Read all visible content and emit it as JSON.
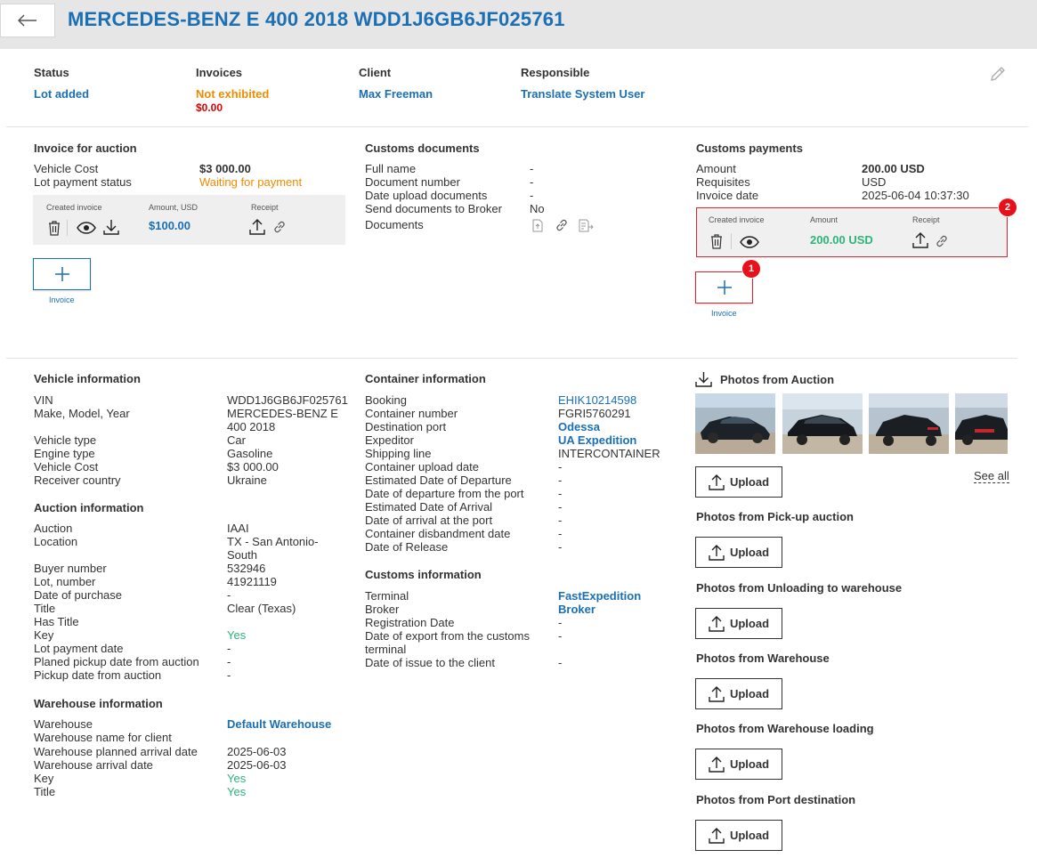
{
  "header": {
    "title": "MERCEDES-BENZ E 400 2018 WDD1J6GB6JF025761"
  },
  "summary": {
    "status_label": "Status",
    "status_value": "Lot added",
    "invoices_label": "Invoices",
    "invoices_value": "Not exhibited",
    "invoices_amount": "$0.00",
    "client_label": "Client",
    "client_value": "Max Freeman",
    "responsible_label": "Responsible",
    "responsible_value": "Translate System User"
  },
  "invoice_auction": {
    "title": "Invoice for auction",
    "rows": [
      {
        "k": "Vehicle Cost",
        "v": "$3 000.00"
      },
      {
        "k": "Lot payment status",
        "v": "Waiting for payment"
      }
    ],
    "table": {
      "col1": "Created invoice",
      "col2": "Amount, USD",
      "col3": "Receipt",
      "amount": "$100.00"
    },
    "add_label": "Invoice"
  },
  "customs_docs": {
    "title": "Customs documents",
    "rows": [
      {
        "k": "Full name",
        "v": "-"
      },
      {
        "k": "Document number",
        "v": "-"
      },
      {
        "k": "Date upload documents",
        "v": "-"
      },
      {
        "k": "Send documents to Broker",
        "v": "No"
      },
      {
        "k": "Documents",
        "v": ""
      }
    ]
  },
  "customs_payments": {
    "title": "Customs payments",
    "rows": [
      {
        "k": "Amount",
        "v": "200.00 USD"
      },
      {
        "k": "Requisites",
        "v": "USD"
      },
      {
        "k": "Invoice date",
        "v": "2025-06-04 10:37:30"
      }
    ],
    "table": {
      "col1": "Created invoice",
      "col2": "Amount",
      "col3": "Receipt",
      "amount": "200.00 USD"
    },
    "add_label": "Invoice",
    "badge1": "1",
    "badge2": "2"
  },
  "vehicle_info": {
    "title": "Vehicle information",
    "rows": [
      {
        "k": "VIN",
        "v": "WDD1J6GB6JF025761"
      },
      {
        "k": "Make, Model, Year",
        "v": "MERCEDES-BENZ E",
        "v2": "400 2018"
      },
      {
        "k": "Vehicle type",
        "v": "Car"
      },
      {
        "k": "Engine type",
        "v": "Gasoline"
      },
      {
        "k": "Vehicle Cost",
        "v": "$3 000.00"
      },
      {
        "k": "Receiver country",
        "v": "Ukraine"
      }
    ]
  },
  "auction_info": {
    "title": "Auction information",
    "rows": [
      {
        "k": "Auction",
        "v": "IAAI"
      },
      {
        "k": "Location",
        "v": "TX - San Antonio-",
        "v2": "South"
      },
      {
        "k": "Buyer number",
        "v": "532946"
      },
      {
        "k": "Lot, number",
        "v": "41921119"
      },
      {
        "k": "Date of purchase",
        "v": "-"
      },
      {
        "k": "Title",
        "v": "Clear (Texas)"
      },
      {
        "k": "Has Title",
        "v": ""
      },
      {
        "k": "Key",
        "v": "Yes"
      },
      {
        "k": "Lot payment date",
        "v": "-"
      },
      {
        "k": "Planed pickup date from auction",
        "v": "-"
      },
      {
        "k": "Pickup date from auction",
        "v": "-"
      }
    ]
  },
  "warehouse_info": {
    "title": "Warehouse information",
    "rows": [
      {
        "k": "Warehouse",
        "v": "Default Warehouse"
      },
      {
        "k": "Warehouse name for client",
        "v": ""
      },
      {
        "k": "Warehouse planned arrival date",
        "v": "2025-06-03"
      },
      {
        "k": "Warehouse arrival date",
        "v": "2025-06-03"
      },
      {
        "k": "Key",
        "v": "Yes"
      },
      {
        "k": "Title",
        "v": "Yes"
      }
    ]
  },
  "container_info": {
    "title": "Container information",
    "rows": [
      {
        "k": "Booking",
        "v": "EHIK10214598"
      },
      {
        "k": "Container number",
        "v": "FGRI5760291"
      },
      {
        "k": "Destination port",
        "v": "Odessa"
      },
      {
        "k": "Expeditor",
        "v": "UA Expedition"
      },
      {
        "k": "Shipping line",
        "v": "INTERCONTAINER"
      },
      {
        "k": "Container upload date",
        "v": "-"
      },
      {
        "k": "Estimated Date of Departure",
        "v": "-"
      },
      {
        "k": "Date of departure from the port",
        "v": "-"
      },
      {
        "k": "Estimated Date of Arrival",
        "v": "-"
      },
      {
        "k": "Date of arrival at the port",
        "v": "-"
      },
      {
        "k": "Container disbandment date",
        "v": "-"
      },
      {
        "k": "Date of Release",
        "v": "-"
      }
    ]
  },
  "customs_info": {
    "title": "Customs information",
    "rows": [
      {
        "k": "Terminal",
        "v": "FastExpedition"
      },
      {
        "k": "Broker",
        "v": "Broker"
      },
      {
        "k": "Registration Date",
        "v": "-"
      },
      {
        "k": "Date of export from the customs",
        "k2": "terminal",
        "v": "-"
      },
      {
        "k": "Date of issue to the client",
        "v": "-"
      }
    ]
  },
  "photos": {
    "auction_title": "Photos from Auction",
    "see_all": "See all",
    "upload_label": "Upload",
    "sections": [
      "Photos from Pick-up auction",
      "Photos from Unloading to warehouse",
      "Photos from Warehouse",
      "Photos from Warehouse loading",
      "Photos from Port destination"
    ]
  },
  "colors": {
    "accent": "#1a6fb5",
    "orange": "#f08a00",
    "green": "#2cb57b",
    "red": "#e8101a"
  }
}
